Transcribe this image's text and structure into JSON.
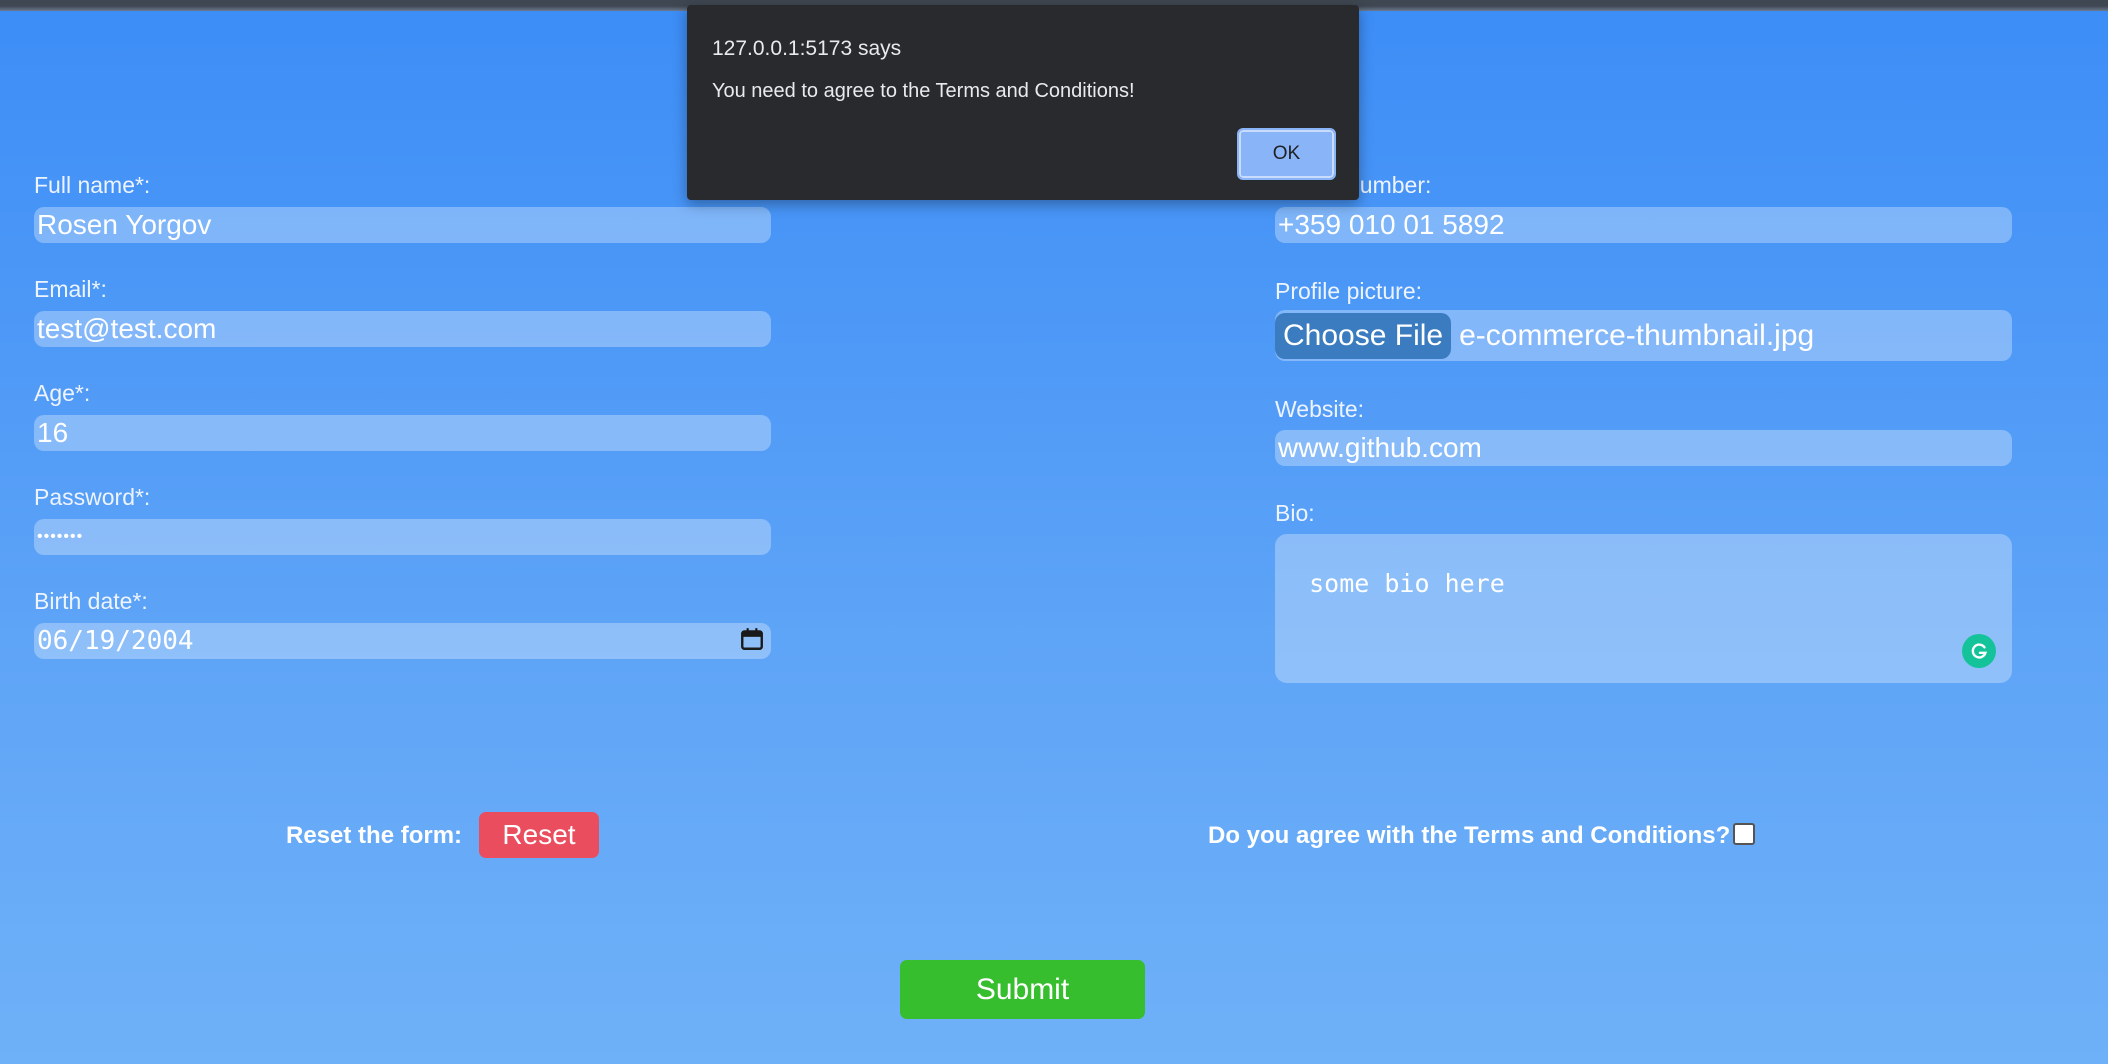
{
  "form": {
    "left": {
      "full_name": {
        "label": "Full name*:",
        "value": "Rosen Yorgov"
      },
      "email": {
        "label": "Email*:",
        "value": "test@test.com"
      },
      "age": {
        "label": "Age*:",
        "value": "16"
      },
      "password": {
        "label": "Password*:",
        "value": "•••••••"
      },
      "birth_date": {
        "label": "Birth date*:",
        "value": "06/19/2004"
      }
    },
    "right": {
      "phone": {
        "label": "number:",
        "value": "+359 010 01 5892"
      },
      "profile_picture": {
        "label": "Profile picture:",
        "button_label": "Choose File",
        "file_name": "e-commerce-thumbnail.jpg"
      },
      "website": {
        "label": "Website:",
        "value": "www.github.com"
      },
      "bio": {
        "label": "Bio:",
        "value": "some bio here"
      }
    }
  },
  "actions": {
    "reset_label": "Reset the form:",
    "reset_button": "Reset",
    "terms_label": "Do you agree with the Terms and Conditions?",
    "terms_checked": false,
    "submit_button": "Submit"
  },
  "dialog": {
    "title": "127.0.0.1:5173 says",
    "message": "You need to agree to the Terms and Conditions!",
    "ok_button": "OK"
  },
  "icons": {
    "calendar": "calendar-icon",
    "grammarly": "grammarly-icon"
  },
  "colors": {
    "reset": "#ea4e5e",
    "submit": "#36be2e",
    "dialog_bg": "#292a2d",
    "dialog_ok": "#8ab4f8",
    "choose_file": "#3b7cc0"
  }
}
